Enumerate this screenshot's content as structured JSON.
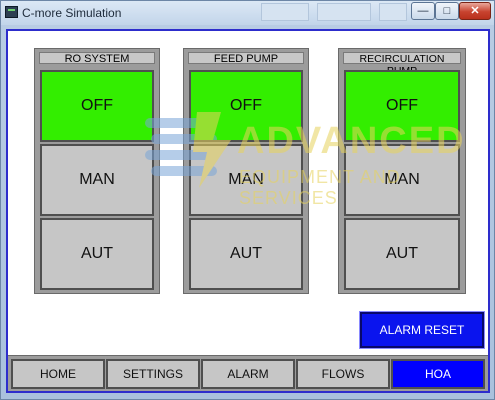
{
  "window": {
    "title": "C-more Simulation",
    "buttons": {
      "minimize": "—",
      "maximize": "□",
      "close": "✕"
    }
  },
  "panels": [
    {
      "title": "RO SYSTEM",
      "buttons": [
        "OFF",
        "MAN",
        "AUT"
      ],
      "active": "OFF"
    },
    {
      "title": "FEED PUMP",
      "buttons": [
        "OFF",
        "MAN",
        "AUT"
      ],
      "active": "OFF"
    },
    {
      "title": "RECIRCULATION PUMP",
      "buttons": [
        "OFF",
        "MAN",
        "AUT"
      ],
      "active": "OFF"
    }
  ],
  "watermark": {
    "line1": "ADVANCED",
    "line2": "EQUIPMENT AND SERVICES"
  },
  "alarm_reset_label": "ALARM RESET",
  "nav": {
    "items": [
      "HOME",
      "SETTINGS",
      "ALARM",
      "FLOWS",
      "HOA"
    ],
    "active": "HOA"
  },
  "colors": {
    "active_green": "#33ee00",
    "inactive_grey": "#c6c6c6",
    "accent_blue": "#0000ff"
  }
}
